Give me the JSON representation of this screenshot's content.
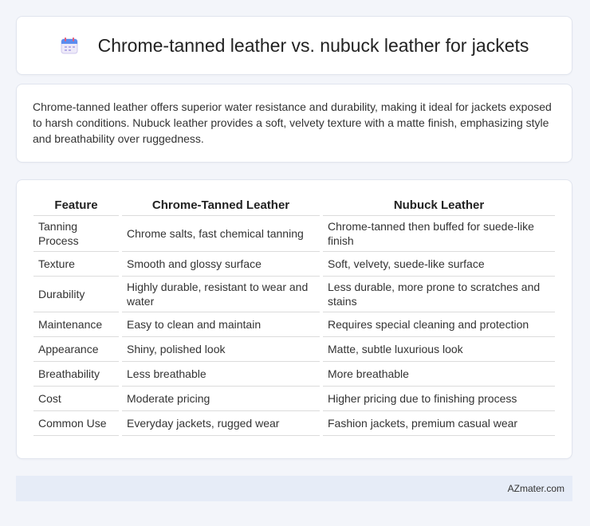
{
  "header": {
    "title": "Chrome-tanned leather vs. nubuck leather for jackets",
    "icon": "calendar-icon"
  },
  "summary": {
    "text": "Chrome-tanned leather offers superior water resistance and durability, making it ideal for jackets exposed to harsh conditions. Nubuck leather provides a soft, velvety texture with a matte finish, emphasizing style and breathability over ruggedness."
  },
  "table": {
    "headers": [
      "Feature",
      "Chrome-Tanned Leather",
      "Nubuck Leather"
    ],
    "rows": [
      [
        "Tanning Process",
        "Chrome salts, fast chemical tanning",
        "Chrome-tanned then buffed for suede-like finish"
      ],
      [
        "Texture",
        "Smooth and glossy surface",
        "Soft, velvety, suede-like surface"
      ],
      [
        "Durability",
        "Highly durable, resistant to wear and water",
        "Less durable, more prone to scratches and stains"
      ],
      [
        "Maintenance",
        "Easy to clean and maintain",
        "Requires special cleaning and protection"
      ],
      [
        "Appearance",
        "Shiny, polished look",
        "Matte, subtle luxurious look"
      ],
      [
        "Breathability",
        "Less breathable",
        "More breathable"
      ],
      [
        "Cost",
        "Moderate pricing",
        "Higher pricing due to finishing process"
      ],
      [
        "Common Use",
        "Everyday jackets, rugged wear",
        "Fashion jackets, premium casual wear"
      ]
    ]
  },
  "footer": {
    "brand": "AZmater.com"
  }
}
